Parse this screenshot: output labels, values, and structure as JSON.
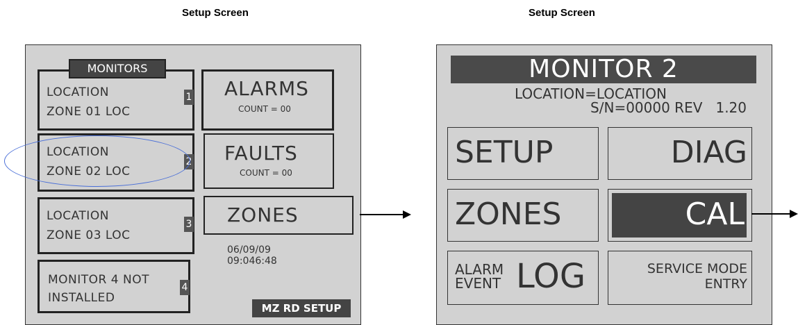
{
  "captions": {
    "left": "Setup Screen",
    "right": "Setup Screen"
  },
  "left_screen": {
    "monitors_tab": "MONITORS",
    "monitors": [
      {
        "location": "LOCATION",
        "zone": "ZONE  01  LOC",
        "number": "1"
      },
      {
        "location": "LOCATION",
        "zone": "ZONE 02  LOC",
        "number": "2"
      },
      {
        "location": "LOCATION",
        "zone": "ZONE 03  LOC",
        "number": "3"
      },
      {
        "line1": "MONITOR 4 NOT",
        "line2": "INSTALLED",
        "number": "4"
      }
    ],
    "alarms": {
      "title": "ALARMS",
      "count": "COUNT = 00"
    },
    "faults": {
      "title": "FAULTS",
      "count": "COUNT = 00"
    },
    "zones": {
      "title": "ZONES"
    },
    "date": "06/09/09",
    "time": "09:046:48",
    "setup_button": "MZ RD SETUP"
  },
  "right_screen": {
    "title": "MONITOR  2",
    "location_line": "LOCATION=LOCATION",
    "sn_line": "S/N=00000 REV   1.20",
    "buttons": {
      "setup": "SETUP",
      "diag": "DIAG",
      "zones": "ZONES",
      "cal": "CAL",
      "alarm": "ALARM",
      "event": "EVENT",
      "log": "LOG",
      "service1": "SERVICE MODE",
      "service2": "ENTRY"
    }
  },
  "colors": {
    "screen_bg": "#d2d2d2",
    "dark": "#444444",
    "highlight_oval": "#4a6fd8"
  }
}
